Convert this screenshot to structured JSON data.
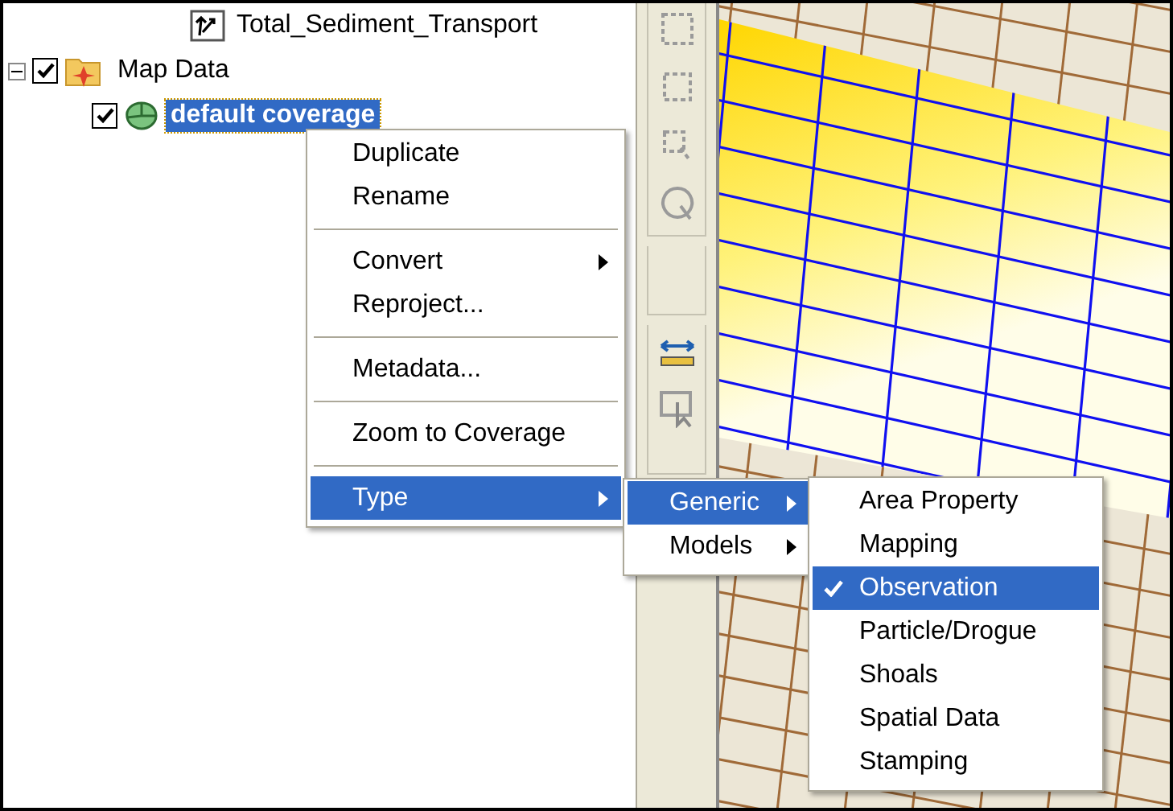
{
  "tree": [
    {
      "label": "Total_Sediment_Transport",
      "selected": false
    },
    {
      "label": "Map Data",
      "checked": true,
      "expanded": true,
      "selected": false,
      "children": [
        {
          "label": "default coverage",
          "checked": true,
          "selected": true
        }
      ]
    }
  ],
  "context_menu": [
    {
      "kind": "item",
      "label": "Duplicate",
      "submenu": false,
      "selected": false
    },
    {
      "kind": "item",
      "label": "Rename",
      "submenu": false,
      "selected": false
    },
    {
      "kind": "separator"
    },
    {
      "kind": "item",
      "label": "Convert",
      "submenu": true,
      "selected": false
    },
    {
      "kind": "item",
      "label": "Reproject...",
      "submenu": false,
      "selected": false
    },
    {
      "kind": "separator"
    },
    {
      "kind": "item",
      "label": "Metadata...",
      "submenu": false,
      "selected": false
    },
    {
      "kind": "separator"
    },
    {
      "kind": "item",
      "label": "Zoom to Coverage",
      "submenu": false,
      "selected": false
    },
    {
      "kind": "separator"
    },
    {
      "kind": "item",
      "label": "Type",
      "submenu": true,
      "selected": true
    }
  ],
  "type_submenu": [
    {
      "label": "Generic",
      "submenu": true,
      "selected": true
    },
    {
      "label": "Models",
      "submenu": true,
      "selected": false
    }
  ],
  "generic_submenu": [
    {
      "label": "Area Property",
      "checked": false,
      "selected": false
    },
    {
      "label": "Mapping",
      "checked": false,
      "selected": false
    },
    {
      "label": "Observation",
      "checked": true,
      "selected": true
    },
    {
      "label": "Particle/Drogue",
      "checked": false,
      "selected": false
    },
    {
      "label": "Shoals",
      "checked": false,
      "selected": false
    },
    {
      "label": "Spatial Data",
      "checked": false,
      "selected": false
    },
    {
      "label": "Stamping",
      "checked": false,
      "selected": false
    }
  ]
}
